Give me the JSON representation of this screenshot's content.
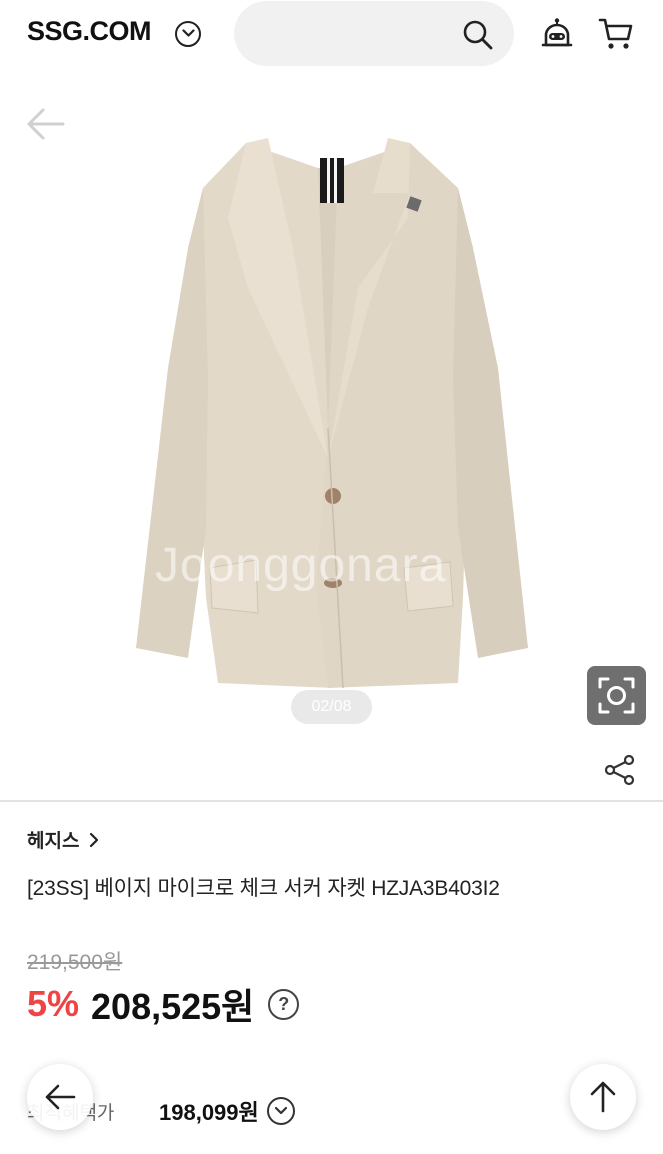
{
  "header": {
    "logo": "SSG.COM",
    "search_placeholder": ""
  },
  "gallery": {
    "counter": "02/08",
    "watermark": "Joonggonara"
  },
  "product": {
    "brand": "헤지스",
    "title": "[23SS] 베이지 마이크로 체크 서커 자켓 HZJA3B403I2",
    "original_price": "219,500원",
    "discount": "5%",
    "sale_price": "208,525원",
    "best_label": "최적혜택가",
    "best_price": "198,099원"
  },
  "colors": {
    "discount": "#ee4444",
    "search_bg": "#f1f1f1",
    "jacket": "#e2d8c8"
  }
}
